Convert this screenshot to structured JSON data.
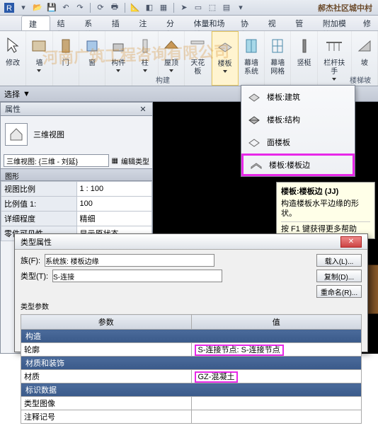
{
  "title": "郝杰社区城中村",
  "qat_icons": [
    "app",
    "open",
    "save",
    "undo",
    "redo",
    "sep",
    "sync",
    "print",
    "sep",
    "cloud",
    "recent",
    "sep",
    "arrow",
    "box",
    "cube",
    "dot",
    "page"
  ],
  "tabs": [
    "建筑",
    "结构",
    "系统",
    "插入",
    "注释",
    "分析",
    "体量和场地",
    "协作",
    "视图",
    "管理",
    "附加模块",
    "修"
  ],
  "active_tab": 0,
  "ribbon": {
    "modify": "修改",
    "wall": "墙",
    "door": "门",
    "window": "窗",
    "component": "构件",
    "column": "柱",
    "roof": "屋顶",
    "ceiling": "天花板",
    "floor": "楼板",
    "curtain_sys": "幕墙\n系统",
    "curtain_grid": "幕墙\n网格",
    "mullion": "竖梃",
    "railing": "栏杆扶手",
    "ramp": "坡",
    "panel_build": "构建",
    "panel_stair": "楼梯坡"
  },
  "optbar": {
    "select": "选择",
    "dd_arrow": "▼"
  },
  "properties": {
    "title": "属性",
    "type": "三维视图",
    "selector": "三维视图: {三维 - 刘延}",
    "edit_type": "编辑类型",
    "graphics_hdr": "图形",
    "rows": [
      {
        "k": "视图比例",
        "v": "1 : 100"
      },
      {
        "k": "比例值 1:",
        "v": "100"
      },
      {
        "k": "详细程度",
        "v": "精细"
      },
      {
        "k": "零件可见性",
        "v": "显示原状态"
      }
    ]
  },
  "dropdown": {
    "items": [
      {
        "label": "楼板:建筑",
        "icon": "slab-arch"
      },
      {
        "label": "楼板:结构",
        "icon": "slab-struct"
      },
      {
        "label": "面楼板",
        "icon": "slab-face"
      },
      {
        "label": "楼板:楼板边",
        "icon": "slab-edge",
        "highlight": true
      }
    ]
  },
  "tooltip": {
    "title": "楼板:楼板边 (JJ)",
    "body": "构造楼板水平边缘的形状。",
    "help": "按 F1 键获得更多帮助"
  },
  "dialog": {
    "title": "类型属性",
    "family_lbl": "族(F):",
    "family_val": "系统族: 楼板边缘",
    "type_lbl": "类型(T):",
    "type_val": "S-连接",
    "load": "载入(L)...",
    "dup": "复制(D)...",
    "rename": "重命名(R)...",
    "params_hdr": "类型参数",
    "col_param": "参数",
    "col_val": "值",
    "sections": [
      {
        "name": "构造",
        "rows": [
          {
            "k": "轮廓",
            "v": "S-连接节点: S-连接节点",
            "hl": true
          }
        ]
      },
      {
        "name": "材质和装饰",
        "rows": [
          {
            "k": "材质",
            "v": "GZ-混凝土",
            "hl": true
          }
        ]
      },
      {
        "name": "标识数据",
        "rows": [
          {
            "k": "类型图像",
            "v": ""
          },
          {
            "k": "注释记号",
            "v": ""
          }
        ]
      }
    ]
  },
  "watermarks": [
    "河南广筑工程咨询有限公司",
    "河南广筑工程咨询有限公司"
  ]
}
